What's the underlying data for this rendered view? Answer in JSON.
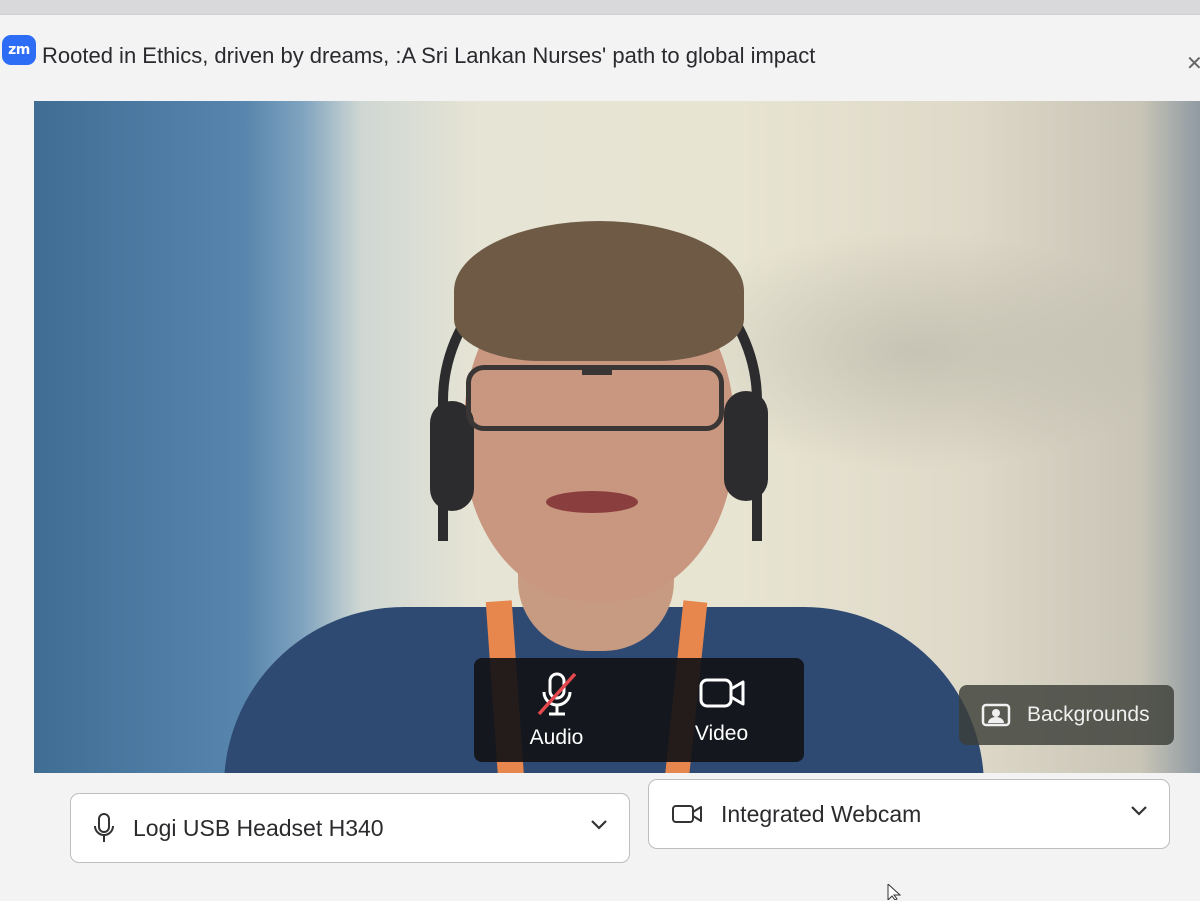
{
  "window": {
    "app_logo": "zm",
    "title": "Rooted in Ethics, driven by dreams, :A Sri Lankan Nurses' path to global impact"
  },
  "preview": {
    "controls": {
      "audio_label": "Audio",
      "audio_icon": "mic-muted-icon",
      "audio_muted": true,
      "video_label": "Video",
      "video_icon": "video-camera-icon"
    },
    "backgrounds_label": "Backgrounds",
    "backgrounds_icon": "portrait-icon"
  },
  "devices": {
    "microphone": {
      "value": "Logi USB Headset H340",
      "icon": "microphone-icon"
    },
    "camera": {
      "value": "Integrated Webcam",
      "icon": "camera-icon"
    }
  },
  "colors": {
    "brand": "#2d6cf5",
    "muted_slash": "#e5484d",
    "control_bg": "#121216"
  }
}
